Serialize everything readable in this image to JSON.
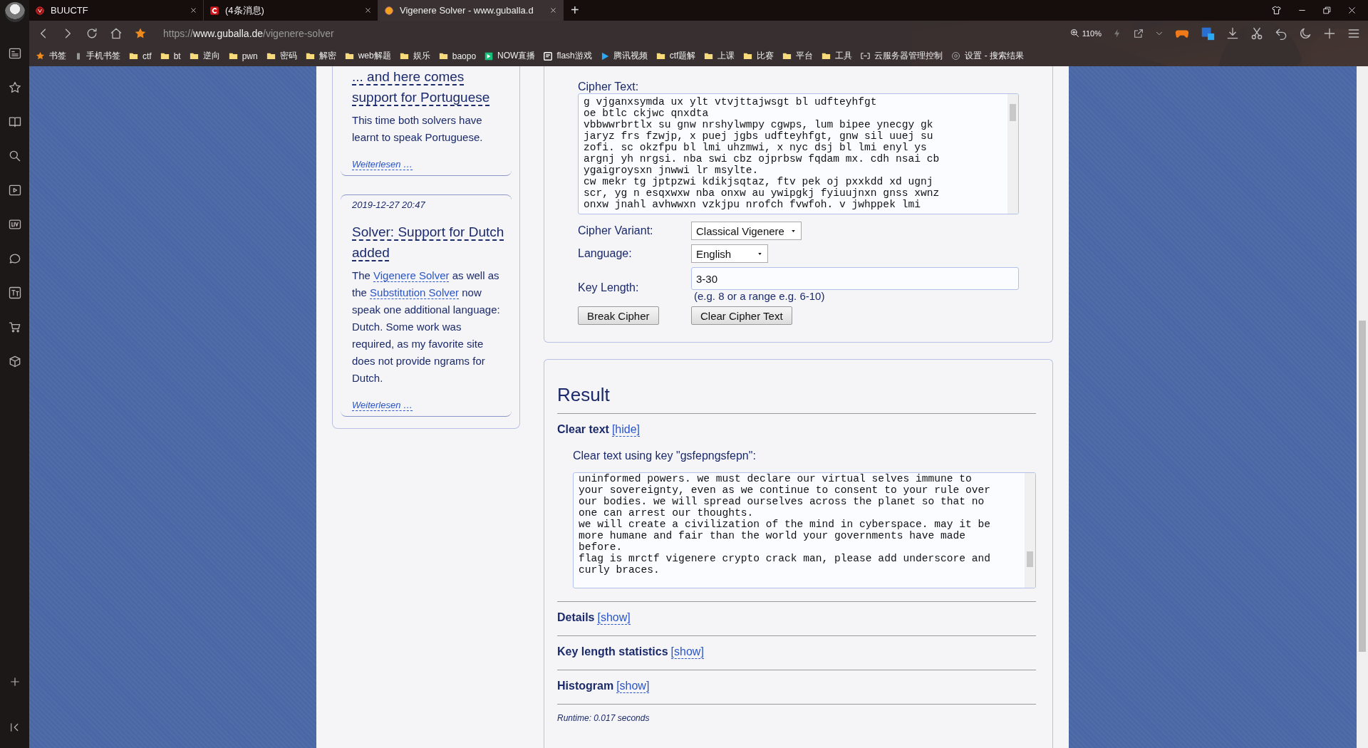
{
  "browser": {
    "tabs": [
      {
        "title": "BUUCTF",
        "selected": false
      },
      {
        "title": "(4条消息)",
        "selected": false
      },
      {
        "title": "Vigenere Solver - www.guballa.d",
        "selected": true
      }
    ],
    "new_tab": "+",
    "address": {
      "scheme": "https://",
      "host": "www.guballa.de",
      "path": "/vigenere-solver"
    },
    "zoom": "110%",
    "bookmarks": [
      {
        "label": "书签",
        "kind": "star"
      },
      {
        "label": "手机书签",
        "kind": "phone"
      },
      {
        "label": "ctf",
        "kind": "folder"
      },
      {
        "label": "bt",
        "kind": "folder"
      },
      {
        "label": "逆向",
        "kind": "folder"
      },
      {
        "label": "pwn",
        "kind": "folder"
      },
      {
        "label": "密码",
        "kind": "folder"
      },
      {
        "label": "解密",
        "kind": "folder"
      },
      {
        "label": "web解题",
        "kind": "folder"
      },
      {
        "label": "娱乐",
        "kind": "folder"
      },
      {
        "label": "baopo",
        "kind": "folder"
      },
      {
        "label": "NOW直播",
        "kind": "now"
      },
      {
        "label": "flash游戏",
        "kind": "flash"
      },
      {
        "label": "腾讯视频",
        "kind": "video"
      },
      {
        "label": "ctf题解",
        "kind": "folder"
      },
      {
        "label": "上课",
        "kind": "folder"
      },
      {
        "label": "比赛",
        "kind": "folder"
      },
      {
        "label": "平台",
        "kind": "folder"
      },
      {
        "label": "工具",
        "kind": "folder"
      },
      {
        "label": "云服务器管理控制",
        "kind": "cloud"
      },
      {
        "label": "设置 - 搜索结果",
        "kind": "gear"
      }
    ]
  },
  "posts": [
    {
      "title": "... and here comes support for Portuguese",
      "body": [
        {
          "text": "This time both solvers have learnt to speak Portuguese.",
          "kind": "text"
        }
      ],
      "more": "Weiterlesen …"
    },
    {
      "date": "2019-12-27 20:47",
      "title": "Solver: Support for Dutch added",
      "body": [
        {
          "text": "The ",
          "kind": "text"
        },
        {
          "text": "Vigenere Solver",
          "kind": "link"
        },
        {
          "text": " as well as the ",
          "kind": "text"
        },
        {
          "text": "Substitution Solver",
          "kind": "link"
        },
        {
          "text": " now speak one additional language: Dutch. Some work was required, as my favorite site does not provide ngrams for Dutch.",
          "kind": "text"
        }
      ],
      "more": "Weiterlesen …"
    }
  ],
  "form": {
    "cipher_label": "Cipher Text:",
    "cipher_text": "g vjganxsymda ux ylt vtvjttajwsgt bl udfteyhfgt\noe btlc ckjwc qnxdta\nvbbwwrbrtlx su gnw nrshylwmpy cgwps, lum bipee ynecgy gk\njaryz frs fzwjp, x puej jgbs udfteyhfgt, gnw sil uuej su\nzofi. sc okzfpu bl lmi uhzmwi, x nyc dsj bl lmi enyl ys\nargnj yh nrgsi. nba swi cbz ojprbsw fqdam mx. cdh nsai cb\nygaigroysxn jnwwi lr msylte.\ncw mekr tg jptpzwi kdikjsqtaz, ftv pek oj pxxkdd xd ugnj\nscr, yg n esqxwxw nba onxw au ywipgkj fyiuujnxn gnss xwnz\nonxw jnahl avhwwxn vzkjpu nrofch fvwfoh. v jwhppek lmi",
    "variant": {
      "label": "Cipher Variant:",
      "value": "Classical Vigenere"
    },
    "language": {
      "label": "Language:",
      "value": "English"
    },
    "key_length": {
      "label": "Key Length:",
      "value": "3-30",
      "hint": "(e.g. 8 or a range e.g. 6-10)"
    },
    "buttons": [
      "Break Cipher",
      "Clear Cipher Text"
    ]
  },
  "result": {
    "title": "Result",
    "sections": [
      {
        "title": "Clear text",
        "toggle": "[hide]",
        "expanded": true,
        "key_line": "Clear text using key \"gsfepngsfepn\":",
        "clear_text": "uninformed powers. we must declare our virtual selves immune to\nyour sovereignty, even as we continue to consent to your rule over\nour bodies. we will spread ourselves across the planet so that no\none can arrest our thoughts.\nwe will create a civilization of the mind in cyberspace. may it be\nmore humane and fair than the world your governments have made\nbefore.\nflag is mrctf vigenere crypto crack man, please add underscore and\ncurly braces."
      },
      {
        "title": "Details",
        "toggle": "[show]",
        "expanded": false
      },
      {
        "title": "Key length statistics",
        "toggle": "[show]",
        "expanded": false
      },
      {
        "title": "Histogram",
        "toggle": "[show]",
        "expanded": false
      }
    ],
    "runtime": "Runtime: 0.017 seconds"
  }
}
